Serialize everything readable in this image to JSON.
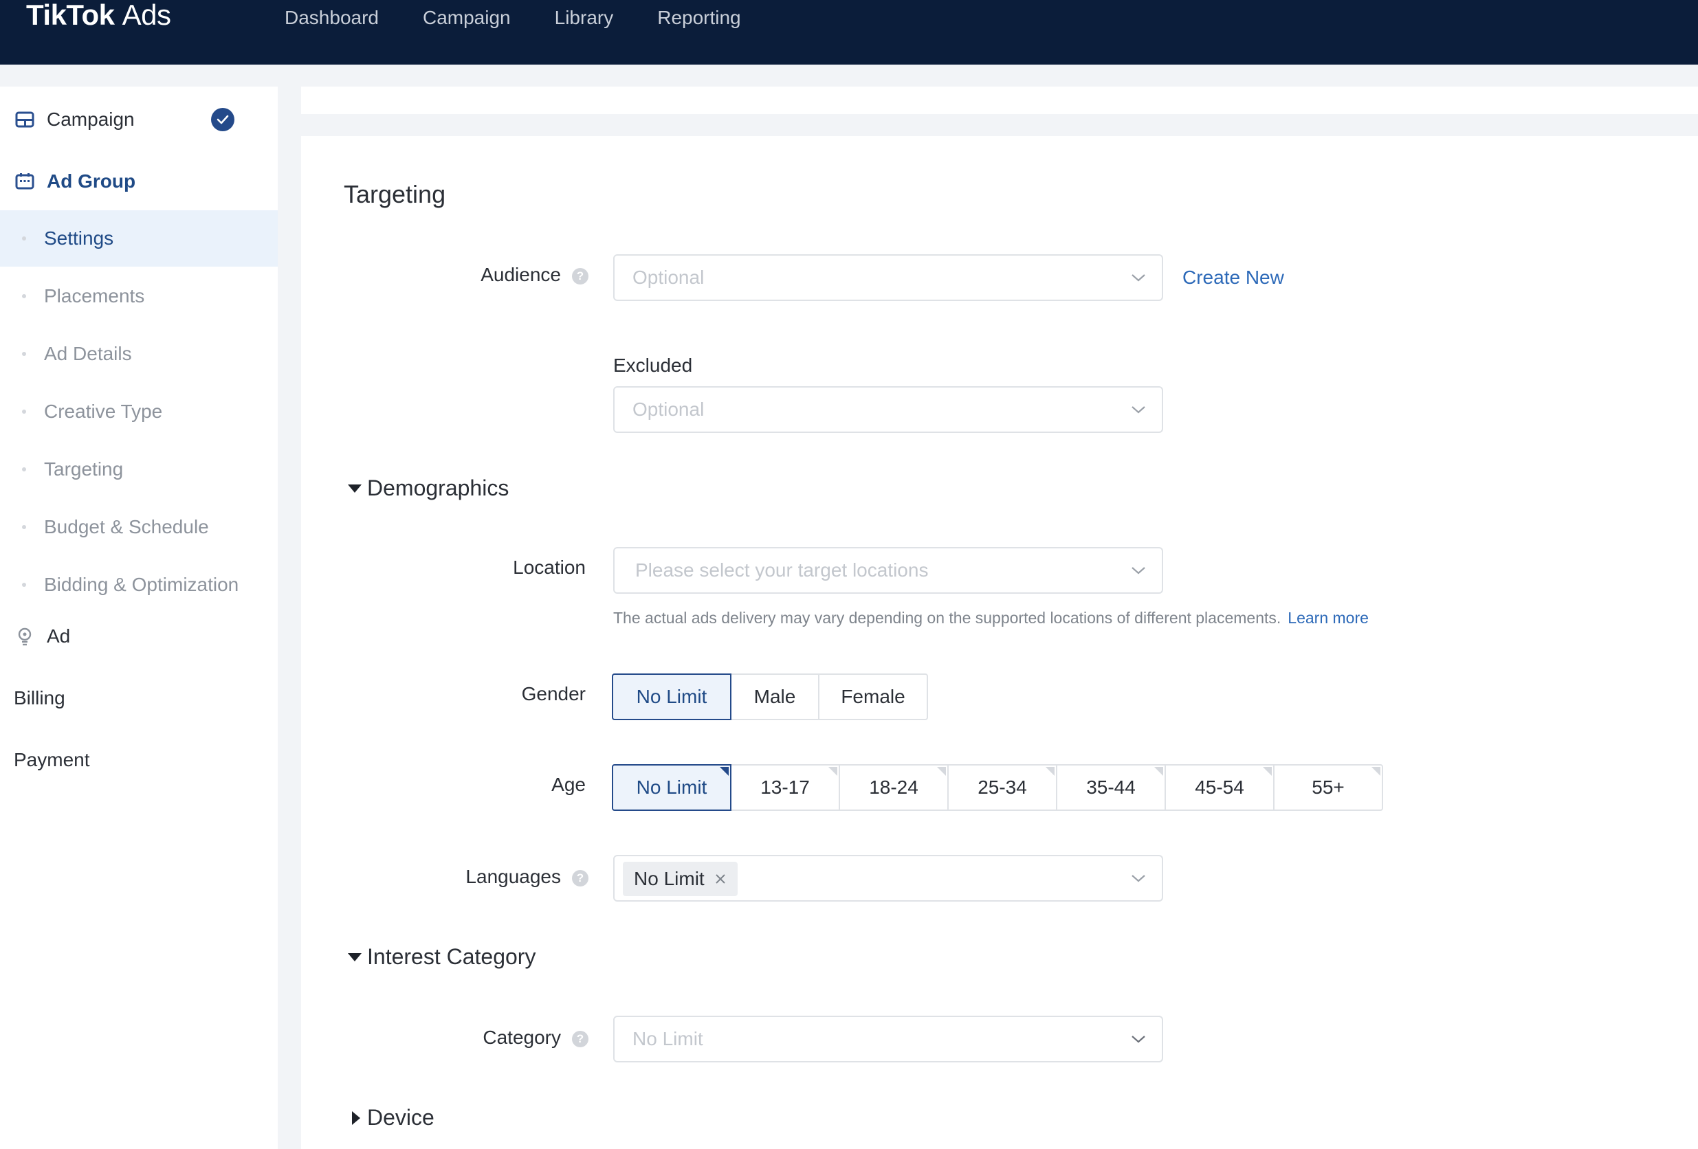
{
  "header": {
    "logo_main": "TikTok",
    "logo_sub": "Ads",
    "nav": [
      "Dashboard",
      "Campaign",
      "Library",
      "Reporting"
    ]
  },
  "sidebar": {
    "campaign": "Campaign",
    "ad_group": "Ad Group",
    "sub_items": [
      "Settings",
      "Placements",
      "Ad Details",
      "Creative Type",
      "Targeting",
      "Budget & Schedule",
      "Bidding & Optimization"
    ],
    "ad": "Ad",
    "billing": "Billing",
    "payment": "Payment"
  },
  "targeting": {
    "title": "Targeting",
    "audience": {
      "label": "Audience",
      "placeholder": "Optional",
      "create_new": "Create New",
      "excluded_label": "Excluded",
      "excluded_placeholder": "Optional"
    },
    "demographics": {
      "title": "Demographics",
      "location_label": "Location",
      "location_placeholder": "Please select your target locations",
      "location_hint": "The actual ads delivery may vary depending on the supported locations of different placements.",
      "learn_more": "Learn more",
      "gender_label": "Gender",
      "gender_options": [
        "No Limit",
        "Male",
        "Female"
      ],
      "gender_selected": "No Limit",
      "age_label": "Age",
      "age_options": [
        "No Limit",
        "13-17",
        "18-24",
        "25-34",
        "35-44",
        "45-54",
        "55+"
      ],
      "age_selected": "No Limit",
      "languages_label": "Languages",
      "languages_tag": "No Limit"
    },
    "interest": {
      "title": "Interest Category",
      "category_label": "Category",
      "category_placeholder": "No Limit"
    },
    "device": {
      "title": "Device"
    }
  },
  "colors": {
    "topbar": "#0b1d3a",
    "accent": "#244a8a",
    "link": "#2c69b8",
    "selected_bg": "#edf3fb"
  }
}
